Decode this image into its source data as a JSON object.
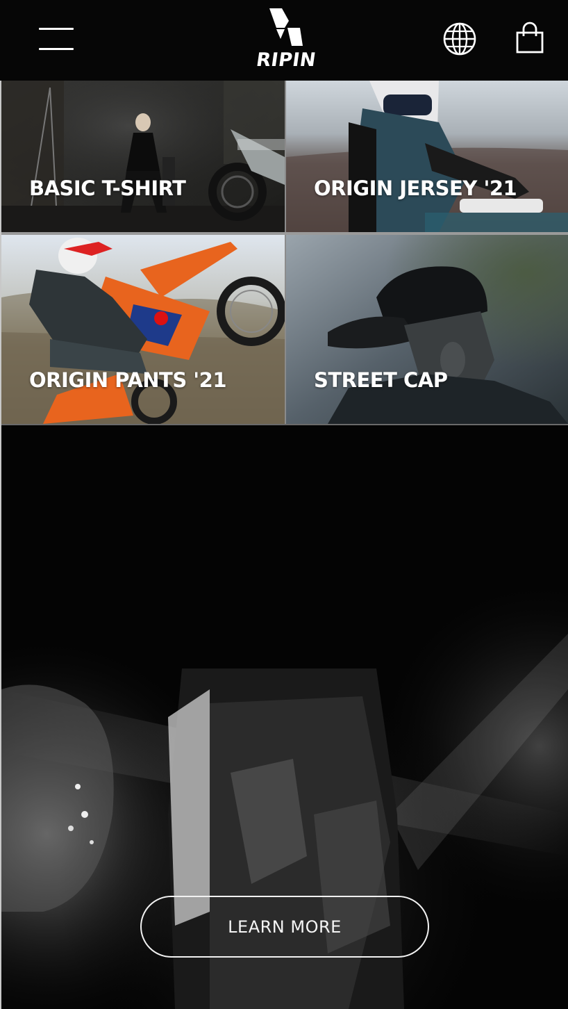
{
  "header": {
    "brand": "RIPIN",
    "menu_icon": "hamburger-menu-icon",
    "language_icon": "globe-icon",
    "cart_icon": "shopping-bag-icon"
  },
  "tiles": [
    {
      "label": "BASIC T-SHIRT"
    },
    {
      "label": "ORIGIN JERSEY '21"
    },
    {
      "label": "ORIGIN PANTS '21"
    },
    {
      "label": "STREET CAP"
    }
  ],
  "hero": {
    "cta_label": "LEARN MORE"
  },
  "colors": {
    "header_bg": "#060606",
    "text": "#ffffff",
    "accent_orange": "#e8641e"
  }
}
